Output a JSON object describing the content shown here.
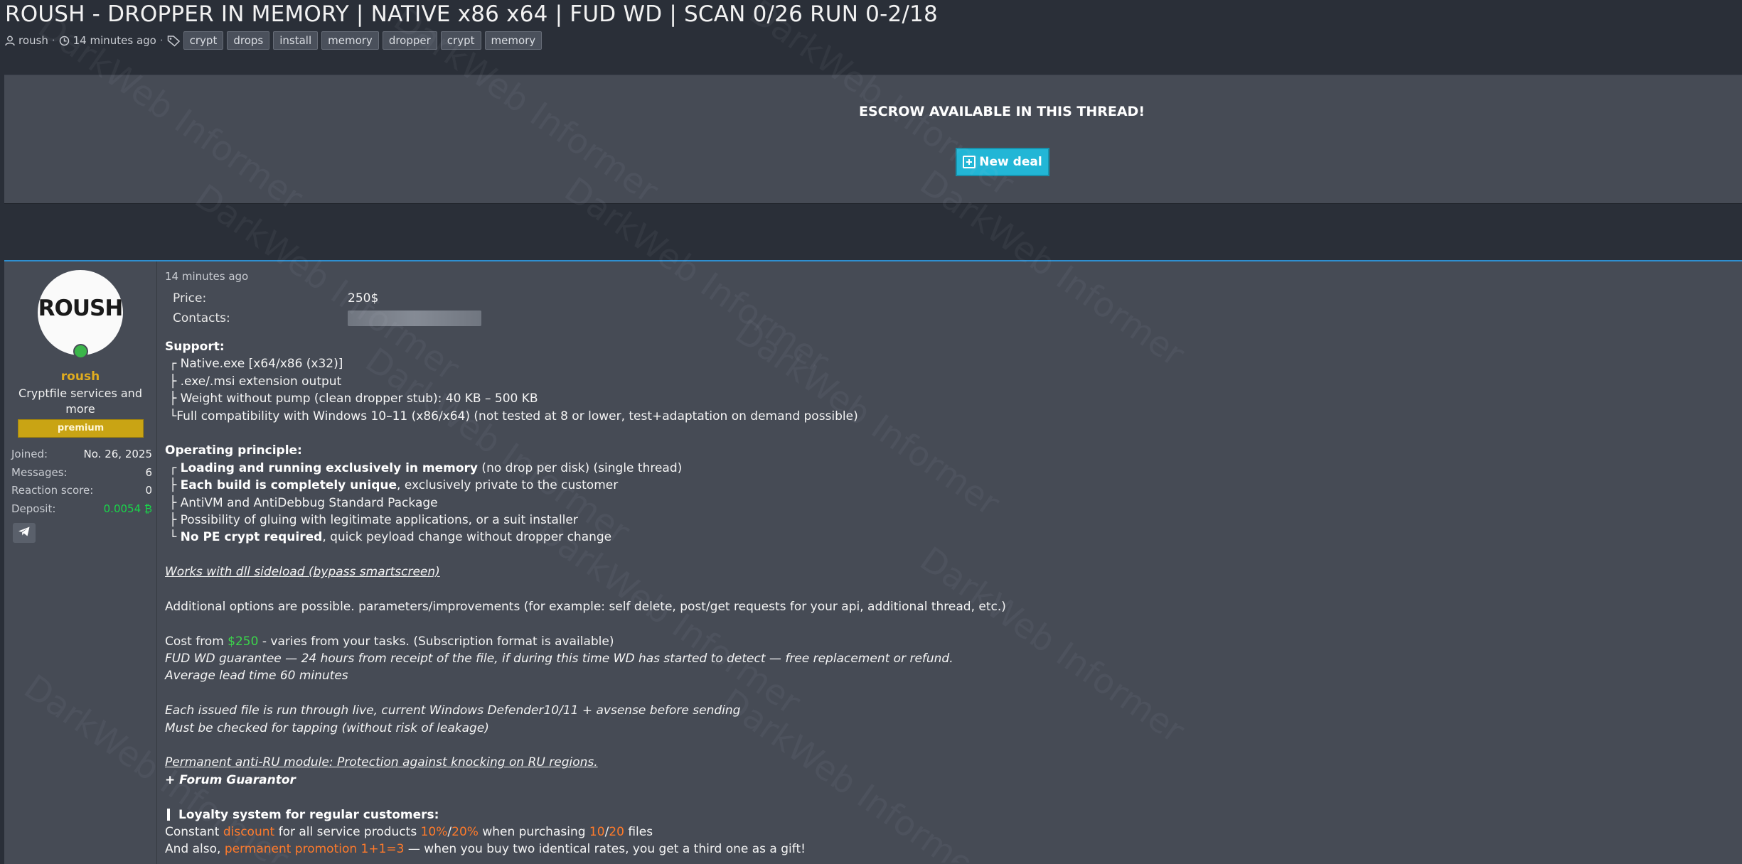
{
  "thread": {
    "title": "ROUSH - DROPPER IN MEMORY | NATIVE x86 x64 | FUD WD | SCAN 0/26 RUN 0-2/18",
    "author": "roush",
    "time": "14 minutes ago",
    "tags": [
      "crypt",
      "drops",
      "install",
      "memory",
      "dropper",
      "crypt",
      "memory"
    ]
  },
  "escrow": {
    "text": "ESCROW AVAILABLE IN THIS THREAD!",
    "button_label": "New deal"
  },
  "user": {
    "avatar_text": "ROUSH",
    "name": "roush",
    "title": "Cryptfile services and more",
    "badge": "premium",
    "stats": [
      {
        "label": "Joined:",
        "value": "No. 26, 2025"
      },
      {
        "label": "Messages:",
        "value": "6"
      },
      {
        "label": "Reaction score:",
        "value": "0"
      },
      {
        "label": "Deposit:",
        "value": "0.0054 ₿"
      }
    ]
  },
  "post": {
    "date": "14 minutes ago",
    "price_label": "Price:",
    "price_value": "250$",
    "contacts_label": "Contacts:",
    "support_heading": "Support:",
    "support": [
      "┌ Native.exe [x64/x86 (x32)]",
      "├ .exe/.msi extension output",
      "├ Weight without pump (clean dropper stub): 40 KB – 500 KB",
      "└Full compatibility with Windows 10–11 (x86/x64) (not tested at 8 or lower, test+adaptation on demand possible)"
    ],
    "operating_heading": "Operating principle:",
    "op1_prefix": "┌ ",
    "op1_bold": "Loading and running exclusively in memory",
    "op1_rest": " (no drop per disk) (single thread)",
    "op2_prefix": "├ ",
    "op2_bold": "Each build is completely unique",
    "op2_rest": ", exclusively private to the customer",
    "op3": "├ AntiVM and AntiDebbug Standard Package",
    "op4": "├ Possibility of gluing with legitimate applications, or a suit installer",
    "op5_prefix": "└ ",
    "op5_bold": "No PE crypt required",
    "op5_rest": ", quick peyload change without dropper change",
    "dll_line": "Works with dll sideload (bypass smartscreen)",
    "additional": "Additional options are possible. parameters/improvements (for example: self delete, post/get requests for your api, additional thread, etc.)",
    "cost_prefix": "Cost from ",
    "cost_value": "$250",
    "cost_rest": " - varies from your tasks. (Subscription format is available)",
    "fud_guarantee": "FUD WD guarantee — 24 hours from receipt of the file, if during this time WD has started to detect — free replacement or refund.",
    "lead_time": "Average lead time 60 minutes",
    "issued_file": "Each issued file is run through live, current Windows Defender10/11 + avsense before sending",
    "tapping": "Must be checked for tapping (without risk of leakage)",
    "anti_ru": "Permanent anti-RU module: Protection against knocking on RU regions.",
    "guarantor": "+ Forum Guarantor",
    "loyalty_heading": "Loyalty system for regular customers:",
    "loyalty1_a": "Constant ",
    "loyalty1_discount": "discount",
    "loyalty1_b": " for all service products ",
    "loyalty1_p1": "10%",
    "loyalty1_slash": "/",
    "loyalty1_p2": "20%",
    "loyalty1_c": " when purchasing ",
    "loyalty1_n1": "10",
    "loyalty1_slash2": "/",
    "loyalty1_n2": "20",
    "loyalty1_d": " files",
    "loyalty2_a": "And also, ",
    "loyalty2_promo": "permanent promotion 1+1=3",
    "loyalty2_b": " — when you buy two identical rates, you get a third one as a gift!"
  },
  "watermark": "DarkWeb Informer",
  "colors": {
    "background": "#2a2f38",
    "panel": "#464b55",
    "accent_blue": "#22b6d6",
    "username_gold": "#e0ac1f",
    "premium_badge": "#c9a414",
    "green": "#3cd54b",
    "orange": "#ff7a2a"
  },
  "icons": [
    "user-icon",
    "clock-icon",
    "tag-icon",
    "plus-square-icon",
    "telegram-icon"
  ]
}
